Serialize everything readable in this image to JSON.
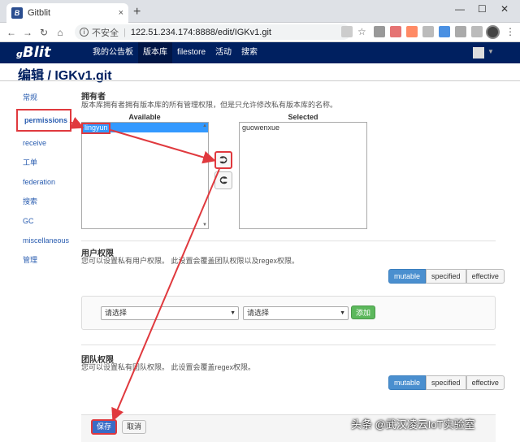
{
  "browser": {
    "tab_title": "Gitblit",
    "tab_close": "×",
    "new_tab": "+",
    "insecure_label": "不安全",
    "url": "122.51.234.174:8888/edit/IGKv1.git",
    "minimize": "—",
    "maximize": "☐",
    "close": "✕"
  },
  "header": {
    "logo": "Blit",
    "logo_prefix": "g",
    "nav": [
      "我的公告板",
      "版本库",
      "filestore",
      "活动",
      "搜索"
    ],
    "active_nav": "版本库"
  },
  "page": {
    "title": "编辑 / IGKv1.git"
  },
  "sidebar": {
    "items": [
      "常规",
      "permissions",
      "receive",
      "工单",
      "federation",
      "搜索",
      "GC",
      "miscellaneous",
      "管理"
    ],
    "active": "permissions"
  },
  "owner": {
    "title": "拥有者",
    "desc": "版本库拥有者拥有版本库的所有管理权限，但是只允许修改私有版本库的名称。",
    "available_label": "Available",
    "selected_label": "Selected",
    "available": [
      "lingyun"
    ],
    "selected": [
      "guowenxue"
    ]
  },
  "user_perms": {
    "title": "用户权限",
    "desc": "您可以设置私有用户权限。 此设置会覆盖团队权限以及regex权限。",
    "modes": [
      "mutable",
      "specified",
      "effective"
    ],
    "active_mode": "mutable",
    "select1": "请选择",
    "select2": "请选择",
    "add_label": "添加"
  },
  "team_perms": {
    "title": "团队权限",
    "desc": "您可以设置私有团队权限。 此设置会覆盖regex权限。",
    "modes": [
      "mutable",
      "specified",
      "effective"
    ],
    "active_mode": "mutable"
  },
  "form": {
    "save_label": "保存",
    "cancel_label": "取消"
  },
  "watermark": "头条 @武汉凌云IoT实验室",
  "colors": {
    "header_bg": "#002060",
    "annotation_red": "#e0393e",
    "primary": "#3a6cc6",
    "success": "#5cb85c"
  }
}
